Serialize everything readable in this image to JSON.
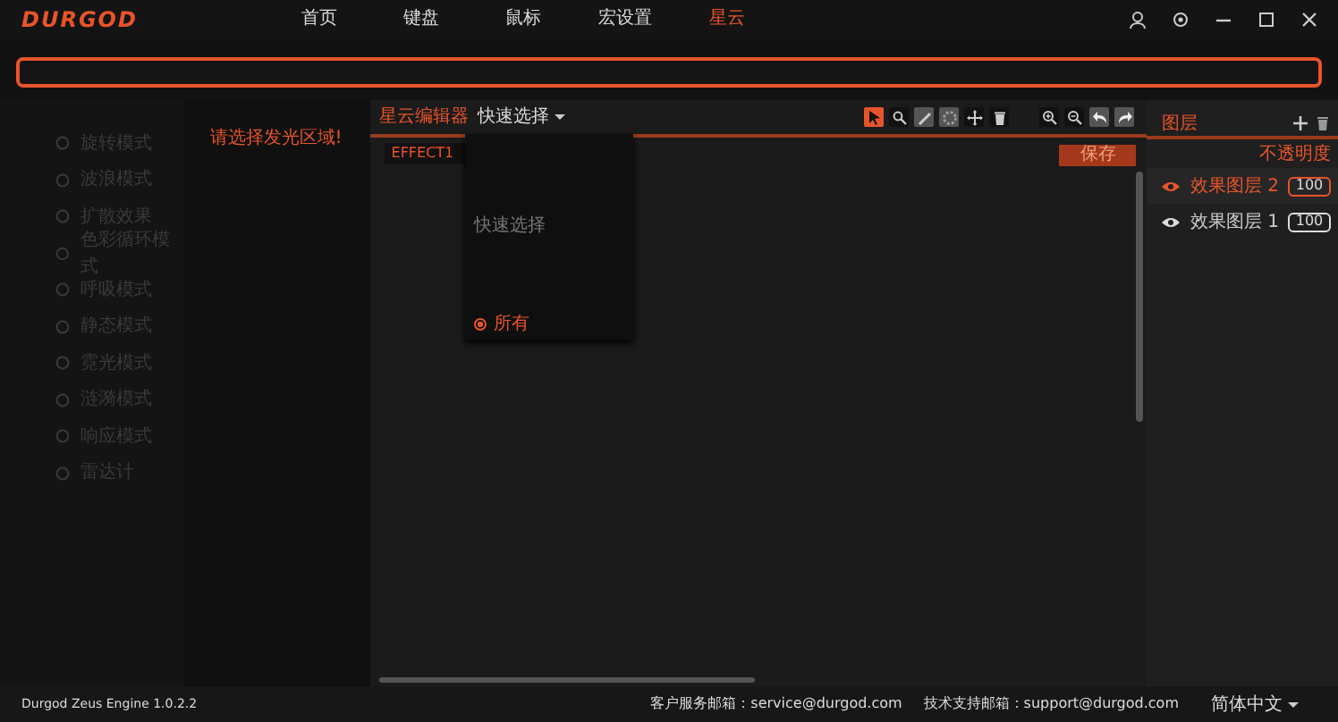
{
  "app": {
    "logo": "DURGOD"
  },
  "nav_tabs": [
    {
      "label": "首页",
      "selected": false
    },
    {
      "label": "键盘",
      "selected": false
    },
    {
      "label": "鼠标",
      "selected": false
    },
    {
      "label": "宏设置",
      "selected": false
    },
    {
      "label": "星云",
      "selected": true
    }
  ],
  "effect_modes": [
    {
      "label": "旋转模式",
      "disabled": true
    },
    {
      "label": "波浪模式",
      "disabled": true
    },
    {
      "label": "扩散效果",
      "disabled": true
    },
    {
      "label": "色彩循环模式",
      "disabled": true
    },
    {
      "label": "呼吸模式",
      "disabled": true
    },
    {
      "label": "静态模式",
      "disabled": true
    },
    {
      "label": "霓光模式",
      "disabled": true
    },
    {
      "label": "涟漪模式",
      "disabled": true
    },
    {
      "label": "响应模式",
      "disabled": true
    },
    {
      "label": "雷达计",
      "disabled": true
    }
  ],
  "prompt": "请选择发光区域!",
  "editor": {
    "title": "星云编辑器",
    "quick_select": "快速选择",
    "effect": "EFFECT1",
    "save": "保存",
    "tools": [
      {
        "kind": "pointer",
        "selected": true
      },
      {
        "kind": "magnifier",
        "selected": false
      },
      {
        "kind": "pencil",
        "selected": false
      },
      {
        "kind": "gear",
        "selected": false
      },
      {
        "kind": "move",
        "selected": false
      },
      {
        "kind": "trash",
        "selected": false
      }
    ],
    "view_tools": [
      {
        "kind": "zoom-in"
      },
      {
        "kind": "zoom-out"
      },
      {
        "kind": "undo"
      },
      {
        "kind": "redo"
      }
    ]
  },
  "quick_select_menu": {
    "heading": "快速选择",
    "options": [
      {
        "label": "所有",
        "selected": true
      }
    ]
  },
  "layers": {
    "title": "图层",
    "opacity_label": "不透明度",
    "items": [
      {
        "name": "效果图层 2",
        "opacity": "100",
        "selected": true
      },
      {
        "name": "效果图层 1",
        "opacity": "100",
        "selected": false
      }
    ]
  },
  "status_bar": {
    "version": "Durgod Zeus Engine 1.0.2.2",
    "service": "客户服务邮箱：service@durgod.com",
    "support": "技术支持邮箱：support@durgod.com",
    "language": "简体中文"
  }
}
